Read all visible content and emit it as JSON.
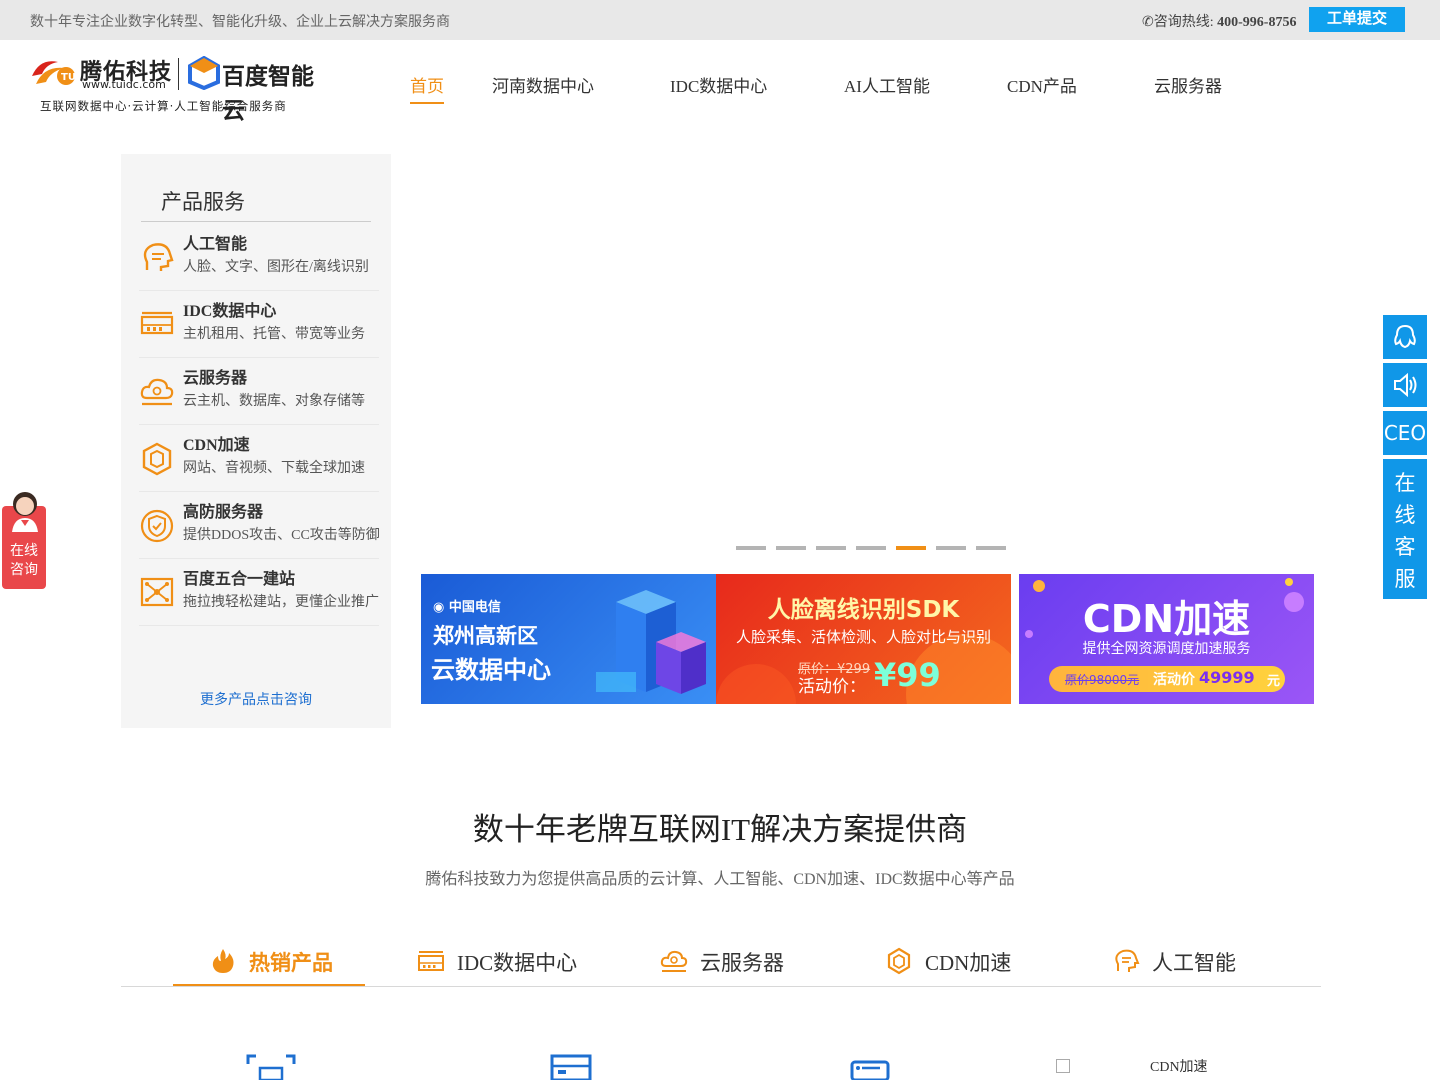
{
  "topbar": {
    "slogan": "数十年专注企业数字化转型、智能化升级、企业上云解决方案服务商",
    "hotline_label": "咨询热线:",
    "hotline_number": "400-996-8756",
    "ticket_button": "工单提交"
  },
  "logo": {
    "company_name": "腾佑科技",
    "url": "www.tuidc.com",
    "partner_name": "百度智能云",
    "tagline": "互联网数据中心·云计算·人工智能综合服务商"
  },
  "nav": {
    "items": [
      "首页",
      "河南数据中心",
      "IDC数据中心",
      "AI人工智能",
      "CDN产品",
      "云服务器"
    ],
    "active_index": 0
  },
  "sidebar": {
    "title": "产品服务",
    "items": [
      {
        "name": "人工智能",
        "desc": "人脸、文字、图形在/离线识别",
        "icon": "ai-head-icon"
      },
      {
        "name": "IDC数据中心",
        "desc": "主机租用、托管、带宽等业务",
        "icon": "server-rack-icon"
      },
      {
        "name": "云服务器",
        "desc": "云主机、数据库、对象存储等",
        "icon": "cloud-gear-icon"
      },
      {
        "name": "CDN加速",
        "desc": "网站、音视频、下载全球加速",
        "icon": "hexagon-icon"
      },
      {
        "name": "高防服务器",
        "desc": "提供DDOS攻击、CC攻击等防御",
        "icon": "shield-check-icon"
      },
      {
        "name": "百度五合一建站",
        "desc": "拖拉拽轻松建站，更懂企业推广",
        "icon": "network-nodes-icon"
      }
    ],
    "more_link": "更多产品点击咨询"
  },
  "slider": {
    "dot_count": 7,
    "active_dot": 4
  },
  "banners": {
    "telecom": {
      "brand": "中国电信",
      "line1": "郑州高新区",
      "line2": "云数据中心"
    },
    "face_sdk": {
      "title": "人脸离线识别SDK",
      "subtitle": "人脸采集、活体检测、人脸对比与识别",
      "original_price": "原价：¥299",
      "activity_label": "活动价：",
      "activity_price": "¥99"
    },
    "cdn": {
      "title": "CDN加速",
      "subtitle": "提供全网资源调度加速服务",
      "original_price": "原价98000元",
      "activity_label": "活动价",
      "activity_price": "49999",
      "unit": "元"
    }
  },
  "section": {
    "title": "数十年老牌互联网IT解决方案提供商",
    "subtitle": "腾佑科技致力为您提供高品质的云计算、人工智能、CDN加速、IDC数据中心等产品"
  },
  "product_tabs": {
    "items": [
      {
        "label": "热销产品",
        "icon": "flame-icon"
      },
      {
        "label": "IDC数据中心",
        "icon": "server-rack-icon"
      },
      {
        "label": "云服务器",
        "icon": "cloud-gear-icon"
      },
      {
        "label": "CDN加速",
        "icon": "hexagon-icon"
      },
      {
        "label": "人工智能",
        "icon": "ai-head-icon"
      }
    ],
    "active_index": 0
  },
  "peek": {
    "cdn_alt": "CDN加速"
  },
  "right_float": {
    "ceo_label": "CEO",
    "online_service": [
      "在",
      "线",
      "客",
      "服"
    ]
  },
  "left_float": {
    "label_line1": "在线",
    "label_line2": "咨询"
  },
  "colors": {
    "accent": "#f08f16",
    "blue": "#1097e8",
    "link": "#1e6fd0",
    "consult_red": "#e9474a"
  }
}
